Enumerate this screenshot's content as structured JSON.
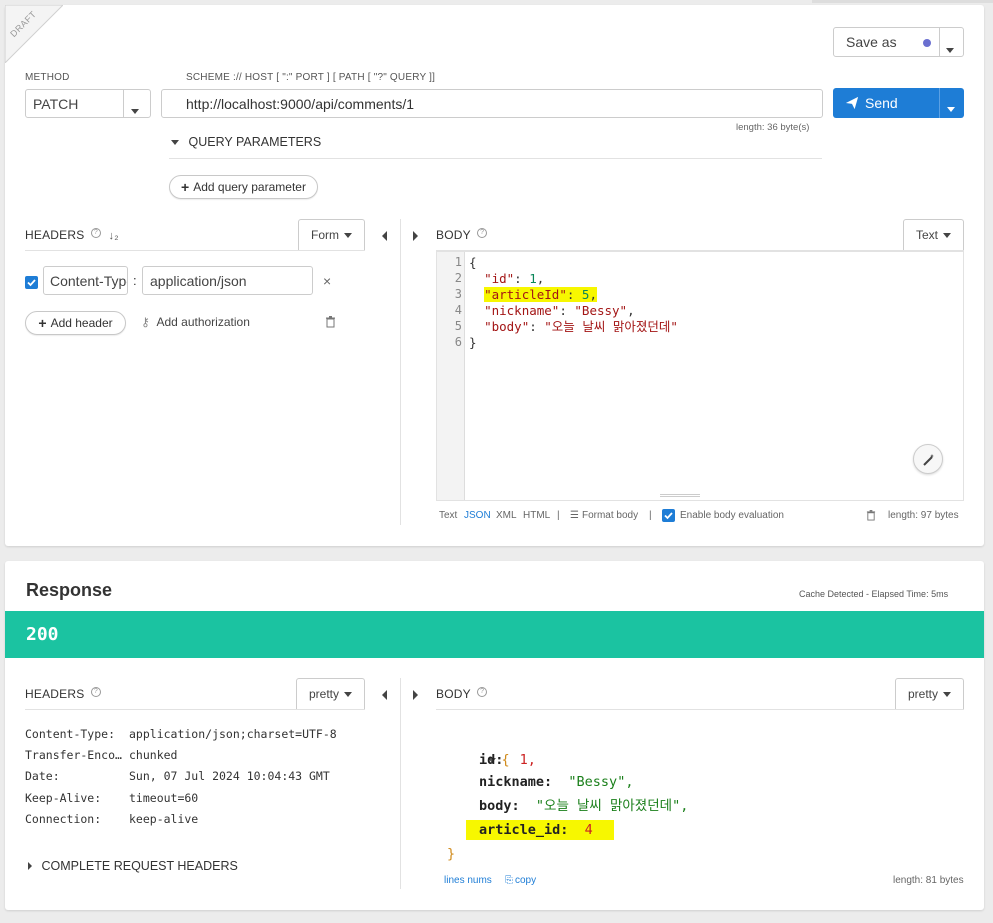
{
  "request": {
    "draft_label": "DRAFT",
    "save_as_label": "Save as",
    "method_label": "METHOD",
    "method_value": "PATCH",
    "url_label": "SCHEME :// HOST [ \":\" PORT ] [ PATH [ \"?\" QUERY ]]",
    "url_value": "http://localhost:9000/api/comments/1",
    "url_length": "length: 36 byte(s)",
    "send_label": "Send",
    "query_params_label": "QUERY PARAMETERS",
    "add_query_param_label": "Add query parameter",
    "headers_label": "HEADERS",
    "form_label": "Form",
    "header_name": "Content-Type",
    "header_value": "application/json",
    "colon": ":",
    "remove_label": "×",
    "add_header_label": "Add header",
    "add_authorization_label": "Add authorization",
    "body_label": "BODY",
    "text_label": "Text",
    "body_lines": {
      "l1": "{",
      "l2_key": "\"id\"",
      "l2_val": "1",
      "l3_key": "\"articleId\"",
      "l3_val": "5",
      "l4_key": "\"nickname\"",
      "l4_val": "\"Bessy\"",
      "l5_key": "\"body\"",
      "l5_val": "\"오늘 날씨 맑아졌던데\"",
      "l6": "}"
    },
    "line_numbers": [
      "1",
      "2",
      "3",
      "4",
      "5",
      "6"
    ],
    "footer": {
      "text": "Text",
      "json": "JSON",
      "xml": "XML",
      "html": "HTML",
      "sep": "|",
      "format_body": "Format body",
      "enable_eval": "Enable body evaluation",
      "length": "length: 97 bytes"
    }
  },
  "response": {
    "title": "Response",
    "cache_info": "Cache Detected - Elapsed Time: 5ms",
    "status_code": "200",
    "status_color": "#1bc3a1",
    "headers_label": "HEADERS",
    "pretty_label": "pretty",
    "headers": [
      {
        "key": "Content-Type:",
        "value": "application/json;charset=UTF-8"
      },
      {
        "key": "Transfer-Encoding:",
        "value": "chunked"
      },
      {
        "key": "Date:",
        "value": "Sun, 07 Jul 2024 10:04:43 GMT"
      },
      {
        "key": "Keep-Alive:",
        "value": "timeout=60"
      },
      {
        "key": "Connection:",
        "value": "keep-alive"
      }
    ],
    "complete_request_headers": "COMPLETE REQUEST HEADERS",
    "body_label": "BODY",
    "body": {
      "open": "{",
      "id_key": "id:",
      "id_val": "1,",
      "nickname_key": "nickname:",
      "nickname_val": "\"Bessy\",",
      "body_key": "body:",
      "body_val": "\"오늘 날씨 맑아졌던데\",",
      "article_key": "article_id:",
      "article_val": "4",
      "close": "}"
    },
    "lines_nums": "lines nums",
    "copy": "copy",
    "length": "length: 81 bytes"
  },
  "colors": {
    "accent": "#1e7dd6",
    "highlight": "#f7f700",
    "success": "#1bc3a1"
  }
}
